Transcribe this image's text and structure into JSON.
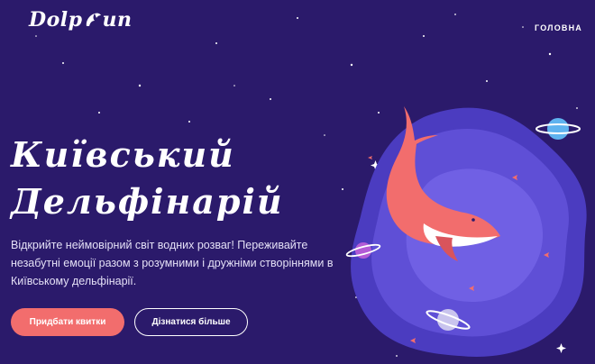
{
  "header": {
    "logo_left": "Dolp",
    "logo_right": "un",
    "nav_home": "ГОЛОВНА"
  },
  "hero": {
    "title_line1": "Київський",
    "title_line2": "Дельфінарій",
    "description": "Відкрийте неймовірний світ водних розваг! Переживайте незабутні емоції разом з розумними і дружніми створіннями в Київському дельфінарії.",
    "buy_button": "Придбати квитки",
    "more_button": "Дізнатися більше"
  },
  "colors": {
    "background": "#2b1a6b",
    "accent": "#f26d6d",
    "blob": "#5f4fd6",
    "blob_light": "#7d6ff0"
  },
  "icons": {
    "logo_mark": "dolphin-icon",
    "whale": "whale-illustration",
    "planet": "planet-icon"
  }
}
